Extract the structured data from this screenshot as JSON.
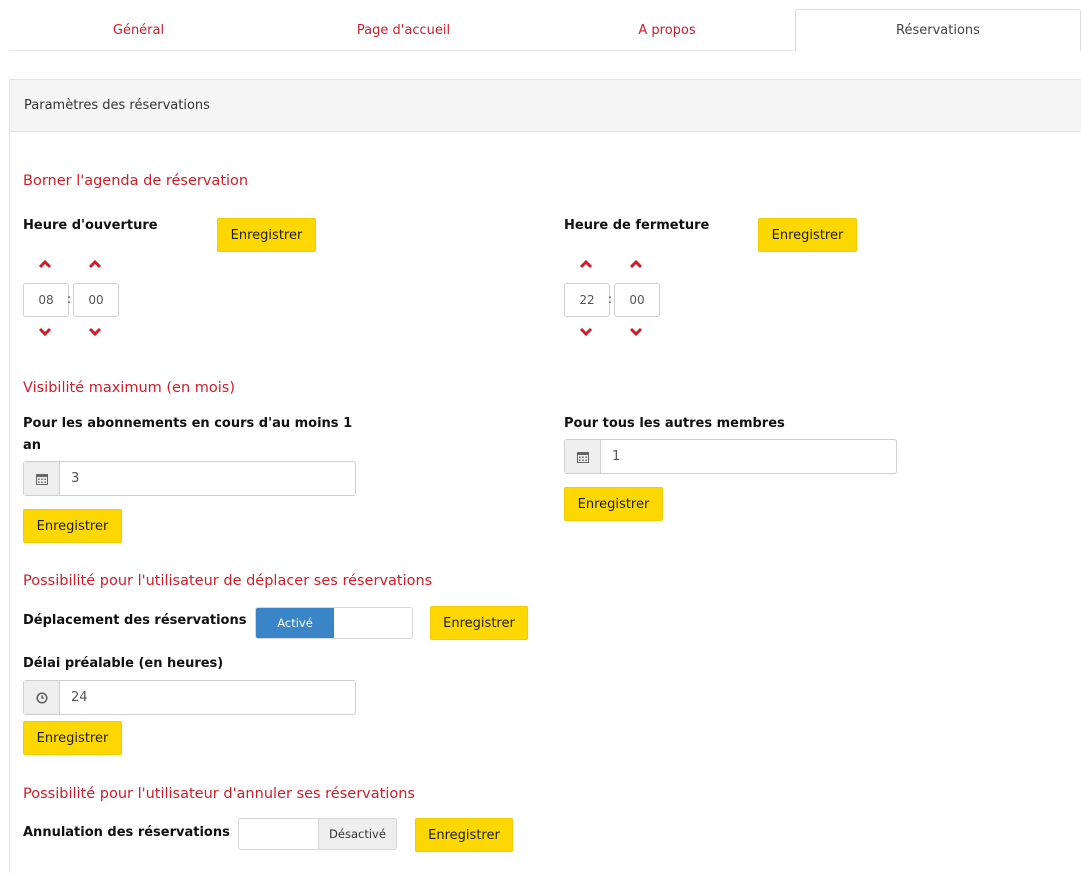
{
  "tabs": [
    {
      "label": "Général"
    },
    {
      "label": "Page d'accueil"
    },
    {
      "label": "A propos"
    },
    {
      "label": "Réservations"
    }
  ],
  "panel": {
    "title": "Paramètres des réservations"
  },
  "agenda": {
    "title": "Borner l'agenda de réservation",
    "opening": {
      "label": "Heure d'ouverture",
      "hours": "08",
      "minutes": "00",
      "save": "Enregistrer"
    },
    "closing": {
      "label": "Heure de fermeture",
      "hours": "22",
      "minutes": "00",
      "save": "Enregistrer"
    },
    "separator": ":"
  },
  "visibility": {
    "title": "Visibilité maximum (en mois)",
    "subscriptions": {
      "label_line1": "Pour les abonnements en cours d'au moins 1",
      "label_line2": "an",
      "value": "3",
      "save": "Enregistrer"
    },
    "others": {
      "label": "Pour tous les autres membres",
      "value": "1",
      "save": "Enregistrer"
    }
  },
  "move": {
    "title": "Possibilité pour l'utilisateur de déplacer ses réservations",
    "label": "Déplacement des réservations",
    "toggle_on": "Activé",
    "save": "Enregistrer",
    "delay_label": "Délai préalable (en heures)",
    "delay_value": "24",
    "delay_save": "Enregistrer"
  },
  "cancel": {
    "title": "Possibilité pour l'utilisateur d'annuler ses réservations",
    "label": "Annulation des réservations",
    "toggle_off": "Désactivé",
    "save": "Enregistrer"
  },
  "colors": {
    "accent": "#cb1e2a",
    "button": "#fdd800",
    "toggle_on": "#3a85c8"
  }
}
